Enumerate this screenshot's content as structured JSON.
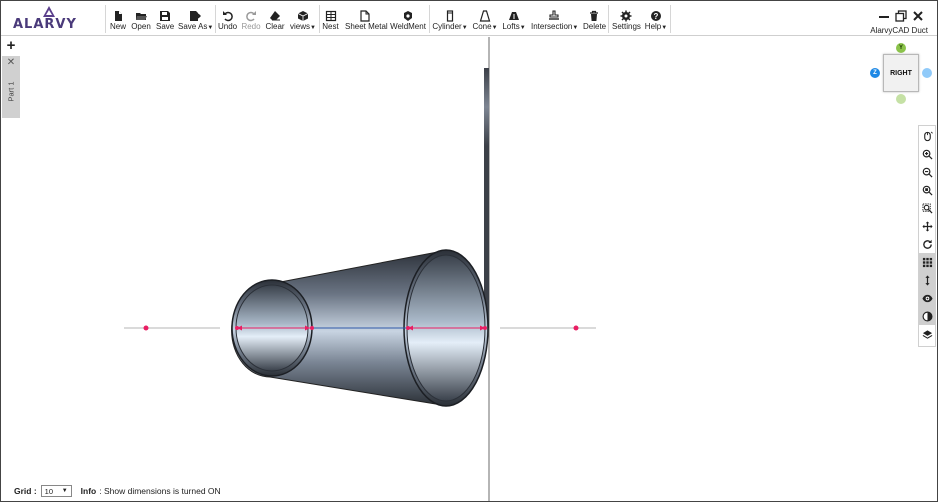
{
  "app": {
    "brand": "ALARVY",
    "name": "AlarvyCAD Duct"
  },
  "toolbar": {
    "new": "New",
    "open": "Open",
    "save": "Save",
    "save_as": "Save As",
    "undo": "Undo",
    "redo": "Redo",
    "clear": "Clear",
    "views": "views",
    "nest": "Nest",
    "sheet_metal": "Sheet Metal",
    "weldment": "WeldMent",
    "cylinder": "Cylinder",
    "cone": "Cone",
    "lofts": "Lofts",
    "intersection": "Intersection",
    "delete": "Delete",
    "settings": "Settings",
    "help": "Help"
  },
  "tabs": {
    "add": "+",
    "close": "✕",
    "part": "Part 1"
  },
  "view_cube": {
    "face": "RIGHT",
    "y_axis": "Y",
    "z_axis": "Z",
    "colors": {
      "y": "#8bc34a",
      "z": "#1e88e5",
      "x": "#90caf9",
      "neg_y": "#c5e1a5"
    }
  },
  "status": {
    "grid_label": "Grid :",
    "grid_value": "10",
    "info_label": "Info",
    "info_text": ": Show dimensions is turned ON"
  },
  "scene": {
    "object": "truncated cone duct",
    "dimension_color": "#e91e63",
    "body_color": "#5a6372"
  }
}
